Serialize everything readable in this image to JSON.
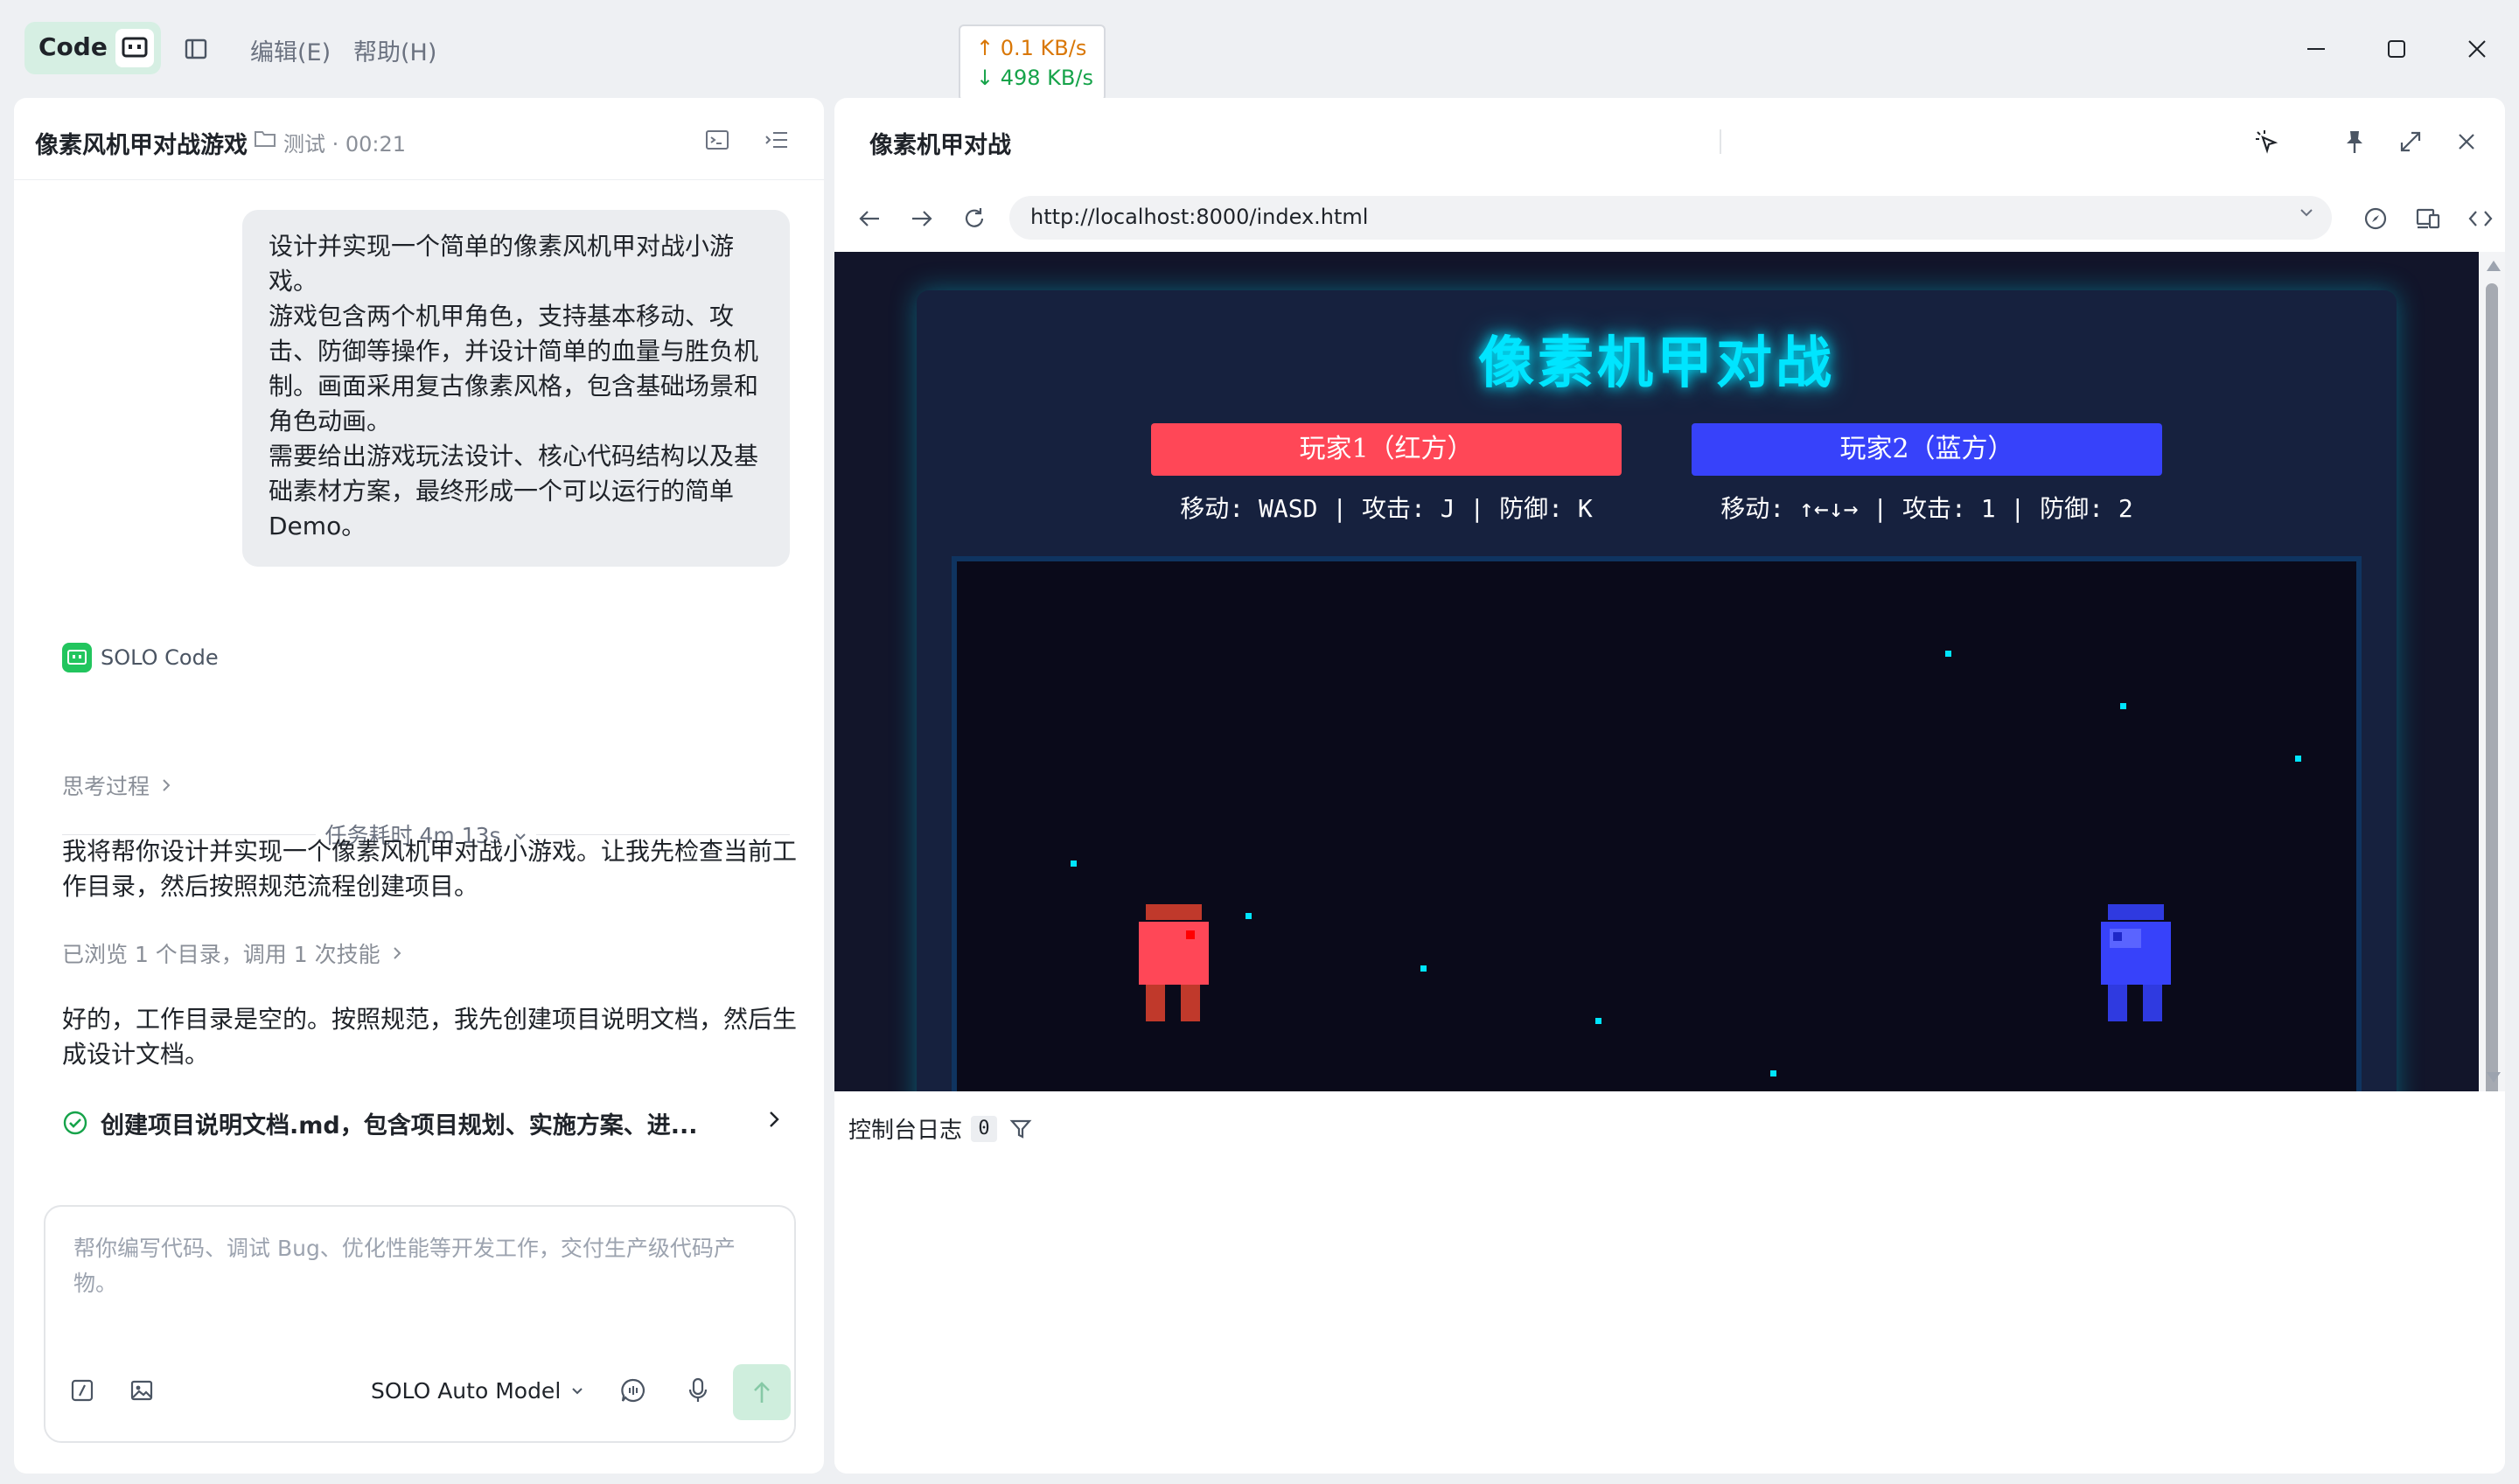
{
  "titlebar": {
    "brand_label": "Code",
    "menu": [
      "编辑(E)",
      "帮助(H)"
    ],
    "net_up": "↑ 0.1 KB/s",
    "net_down": "↓ 498 KB/s"
  },
  "left_panel": {
    "project_title": "像素风机甲对战游戏",
    "session_info": "测试 · 00:21",
    "user_message": [
      "设计并实现一个简单的像素风机甲对战小游戏。",
      "游戏包含两个机甲角色，支持基本移动、攻击、防御等操作，并设计简单的血量与胜负机制。画面采用复古像素风格，包含基础场景和角色动画。",
      "需要给出游戏玩法设计、核心代码结构以及基础素材方案，最终形成一个可以运行的简单 Demo。"
    ],
    "agent_name": "SOLO Code",
    "task_duration": "任务耗时 4m 13s",
    "thinking_label": "思考过程",
    "para1": "我将帮你设计并实现一个像素风机甲对战小游戏。让我先检查当前工作目录，然后按照规范流程创建项目。",
    "browse_label": "已浏览 1 个目录，调用 1 次技能",
    "para2": "好的，工作目录是空的。按照规范，我先创建项目说明文档，然后生成设计文档。",
    "task_item": "创建项目说明文档.md，包含项目规划、实施方案、进..."
  },
  "input": {
    "placeholder": "帮你编写代码、调试 Bug、优化性能等开发工作，交付生产级代码产物。",
    "model_label": "SOLO Auto Model"
  },
  "right_panel": {
    "title": "像素机甲对战",
    "url": "http://localhost:8000/index.html",
    "console_label": "控制台日志",
    "console_count": "0"
  },
  "game": {
    "title": "像素机甲对战",
    "player1_label": "玩家1（红方）",
    "player2_label": "玩家2（蓝方）",
    "player1_controls": "移动: WASD | 攻击: J | 防御: K",
    "player2_controls": "移动: ↑←↓→ | 攻击: 1 | 防御: 2",
    "colors": {
      "accent": "#00e5ff",
      "player1": "#ff4757",
      "player2": "#3742fa",
      "arena_bg": "#0a0a1a",
      "floor": "#2d3436"
    }
  }
}
